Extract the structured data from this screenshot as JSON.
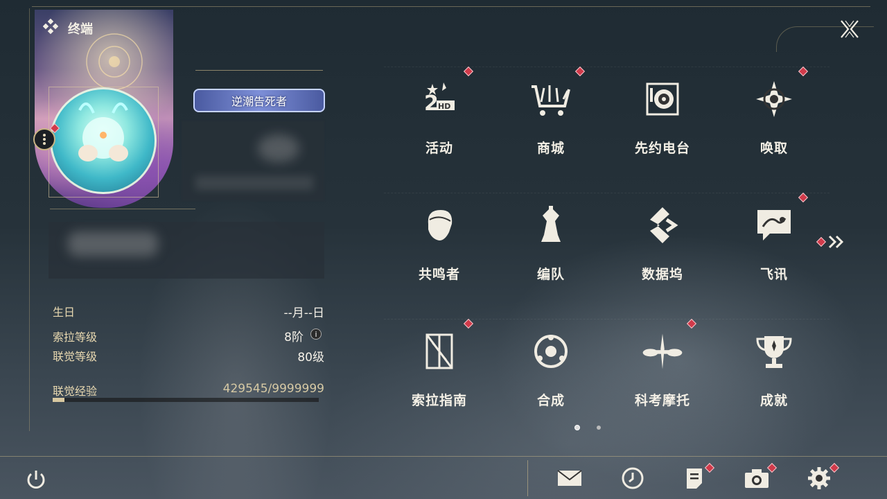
{
  "header": {
    "title": "终端"
  },
  "profile": {
    "title_badge": "逆潮告死者"
  },
  "stats": [
    {
      "label": "生日",
      "value": "--月--日"
    },
    {
      "label": "索拉等级",
      "value": "8阶"
    },
    {
      "label": "联觉等级",
      "value": "80级"
    }
  ],
  "experience": {
    "label": "联觉经验",
    "value": "429545/9999999",
    "progress": 0.043
  },
  "grid": {
    "items": [
      {
        "label": "活动",
        "icon": "event-2hd-icon",
        "badge": true
      },
      {
        "label": "商城",
        "icon": "shop-cart-icon",
        "badge": true
      },
      {
        "label": "先约电台",
        "icon": "radio-icon",
        "badge": false
      },
      {
        "label": "唤取",
        "icon": "compass-star-icon",
        "badge": true
      },
      {
        "label": "共鸣者",
        "icon": "character-head-icon",
        "badge": false
      },
      {
        "label": "编队",
        "icon": "chess-team-icon",
        "badge": false
      },
      {
        "label": "数据坞",
        "icon": "data-dock-icon",
        "badge": false
      },
      {
        "label": "飞讯",
        "icon": "chat-bubble-icon",
        "badge": true
      },
      {
        "label": "索拉指南",
        "icon": "guide-book-icon",
        "badge": true
      },
      {
        "label": "合成",
        "icon": "synthesis-icon",
        "badge": false
      },
      {
        "label": "科考摩托",
        "icon": "motorcycle-icon",
        "badge": true
      },
      {
        "label": "成就",
        "icon": "trophy-icon",
        "badge": false
      }
    ],
    "page_count": 2,
    "current_page": 1
  },
  "bottom_bar": {
    "icons": [
      "power-icon",
      "mail-icon",
      "clock-icon",
      "notice-icon",
      "camera-icon",
      "settings-gear-icon"
    ]
  },
  "colors": {
    "accent_gold": "#c9b485",
    "badge_red": "#d13a4a",
    "title_badge_blue": "#7d8fd8"
  }
}
